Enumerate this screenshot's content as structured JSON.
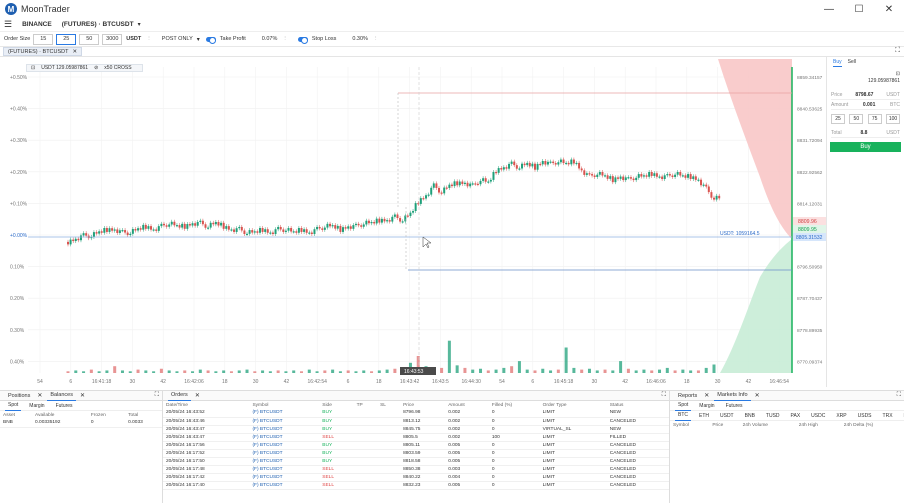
{
  "app": {
    "title": "MoonTrader",
    "logo": "M"
  },
  "window": {
    "minimize": "—",
    "maximize": "☐",
    "close": "✕"
  },
  "menubar": {
    "exchange": "BINANCE",
    "market": "(FUTURES) · BTCUSDT"
  },
  "toolbar": {
    "order_size_label": "Order Size",
    "sizes": [
      "15",
      "25",
      "50",
      "3000"
    ],
    "currency": "USDT",
    "order_mode": "POST ONLY",
    "take_profit_label": "Take Profit",
    "take_profit_value": "0.07%",
    "stop_loss_label": "Stop Loss",
    "stop_loss_value": "0.30%"
  },
  "chart_tab": {
    "label": "(FUTURES) · BTCUSDT",
    "close": "✕"
  },
  "chart_info": {
    "balance": "USDT 129.05987861",
    "leverage": "x50 CROSS"
  },
  "chart_data": {
    "type": "line",
    "y_pct_ticks": [
      "+0.50%",
      "+0.40%",
      "+0.30%",
      "+0.20%",
      "+0.10%",
      "+0.00%",
      "0.10%",
      "0.20%",
      "0.30%",
      "0.40%"
    ],
    "y_price_ticks": [
      "8859.34157",
      "8840.53625",
      "8831.72094",
      "8822.92562",
      "8814.12031",
      "8805.31532",
      "8796.50950",
      "8787.70437",
      "8778.89935",
      "8770.09374"
    ],
    "x_ticks": [
      "54",
      "6",
      "16:41:18",
      "30",
      "42",
      "16:42:06",
      "18",
      "30",
      "42",
      "16:42:54",
      "6",
      "18",
      "16:43:42",
      "16:43:5",
      "16:44:30",
      "54",
      "6",
      "16:45:18",
      "30",
      "42",
      "16:46:06",
      "18",
      "30",
      "42",
      "16:46:54"
    ],
    "ask_price": "8809.96",
    "bid_price": "8809.95",
    "last_price": "8805.31532",
    "position_label": "USDT: 1059164.5",
    "crosshair_time": "16:43:53",
    "price_path_pct": [
      -0.03,
      -0.02,
      -0.01,
      -0.01,
      0.0,
      0.01,
      0.01,
      0.0,
      0.0,
      0.01,
      0.02,
      0.01,
      0.02,
      0.03,
      0.02,
      0.02,
      0.03,
      0.03,
      0.02,
      0.03,
      0.02,
      0.01,
      0.01,
      0.0,
      0.0,
      0.01,
      0.0,
      0.01,
      0.01,
      0.0,
      0.01,
      0.0,
      0.01,
      0.02,
      0.02,
      0.01,
      0.02,
      0.02,
      0.03,
      0.03,
      0.04,
      0.04,
      0.05,
      0.04,
      0.06,
      0.1,
      0.12,
      0.15,
      0.13,
      0.15,
      0.16,
      0.16,
      0.15,
      0.17,
      0.16,
      0.2,
      0.21,
      0.22,
      0.21,
      0.22,
      0.21,
      0.23,
      0.22,
      0.23,
      0.22,
      0.23,
      0.2,
      0.18,
      0.19,
      0.18,
      0.17,
      0.18,
      0.17,
      0.18,
      0.18,
      0.19,
      0.18,
      0.18,
      0.19,
      0.18,
      0.18,
      0.17,
      0.14,
      0.11
    ]
  },
  "buy_panel": {
    "tab_buy": "Buy",
    "tab_sell": "Sell",
    "balance": "129.05987861",
    "price_label": "Price",
    "price_value": "8798.67",
    "price_unit": "USDT",
    "amount_label": "Amount",
    "amount_value": "0.001",
    "amount_unit": "BTC",
    "pcts": [
      "25",
      "50",
      "75",
      "100"
    ],
    "total_label": "Total",
    "total_value": "8.8",
    "total_unit": "USDT",
    "buy_button": "Buy"
  },
  "positions_panel": {
    "tab_positions": "Positions",
    "tab_balances": "Balances",
    "sub_tabs": [
      "Spot",
      "Margin",
      "Futures"
    ],
    "headers": [
      "Asset",
      "Available",
      "Frozen",
      "Total"
    ],
    "rows": [
      [
        "BNB",
        "0.00335192",
        "0",
        "0.0033"
      ]
    ]
  },
  "orders_panel": {
    "tab": "Orders",
    "headers": [
      "Date/Time",
      "Symbol",
      "Side",
      "TP",
      "SL",
      "Price",
      "Amount",
      "Filled (%)",
      "Order Type",
      "Status"
    ],
    "rows": [
      [
        "20/05/24 16:43:52",
        "(F) BTCUSDT",
        "BUY",
        "",
        "",
        "8796.98",
        "0.002",
        "0",
        "LIMIT",
        "NEW"
      ],
      [
        "20/05/24 16:43:46",
        "(F) BTCUSDT",
        "BUY",
        "",
        "",
        "8813.12",
        "0.002",
        "0",
        "LIMIT",
        "CANCELED"
      ],
      [
        "20/05/24 16:43:47",
        "(F) BTCUSDT",
        "BUY",
        "",
        "",
        "8845.75",
        "0.002",
        "0",
        "VIRTUAL_SL",
        "NEW"
      ],
      [
        "20/05/24 16:43:47",
        "(F) BTCUSDT",
        "SELL",
        "",
        "",
        "8805.5",
        "0.002",
        "100",
        "LIMIT",
        "FILLED"
      ],
      [
        "20/05/24 16:17:56",
        "(F) BTCUSDT",
        "BUY",
        "",
        "",
        "8805.11",
        "0.005",
        "0",
        "LIMIT",
        "CANCELED"
      ],
      [
        "20/05/24 16:17:52",
        "(F) BTCUSDT",
        "BUY",
        "",
        "",
        "8803.59",
        "0.005",
        "0",
        "LIMIT",
        "CANCELED"
      ],
      [
        "20/05/24 16:17:50",
        "(F) BTCUSDT",
        "BUY",
        "",
        "",
        "8818.58",
        "0.005",
        "0",
        "LIMIT",
        "CANCELED"
      ],
      [
        "20/05/24 16:17:48",
        "(F) BTCUSDT",
        "SELL",
        "",
        "",
        "8850.38",
        "0.003",
        "0",
        "LIMIT",
        "CANCELED"
      ],
      [
        "20/05/24 16:17:42",
        "(F) BTCUSDT",
        "SELL",
        "",
        "",
        "8840.22",
        "0.004",
        "0",
        "LIMIT",
        "CANCELED"
      ],
      [
        "20/05/24 16:17:40",
        "(F) BTCUSDT",
        "SELL",
        "",
        "",
        "8832.23",
        "0.005",
        "0",
        "LIMIT",
        "CANCELED"
      ]
    ]
  },
  "markets_panel": {
    "tab_reports": "Reports",
    "tab_markets": "Markets Info",
    "sub_tabs": [
      "Spot",
      "Margin",
      "Futures"
    ],
    "currency_tabs": [
      "BTC",
      "ETH",
      "USDT",
      "BNB",
      "TUSD",
      "PAX",
      "USDC",
      "XRP",
      "USDS",
      "TRX",
      "BUSD"
    ],
    "headers": [
      "Symbol",
      "Price",
      "24h Volume",
      "24h High",
      "24h Delta (%)"
    ]
  }
}
